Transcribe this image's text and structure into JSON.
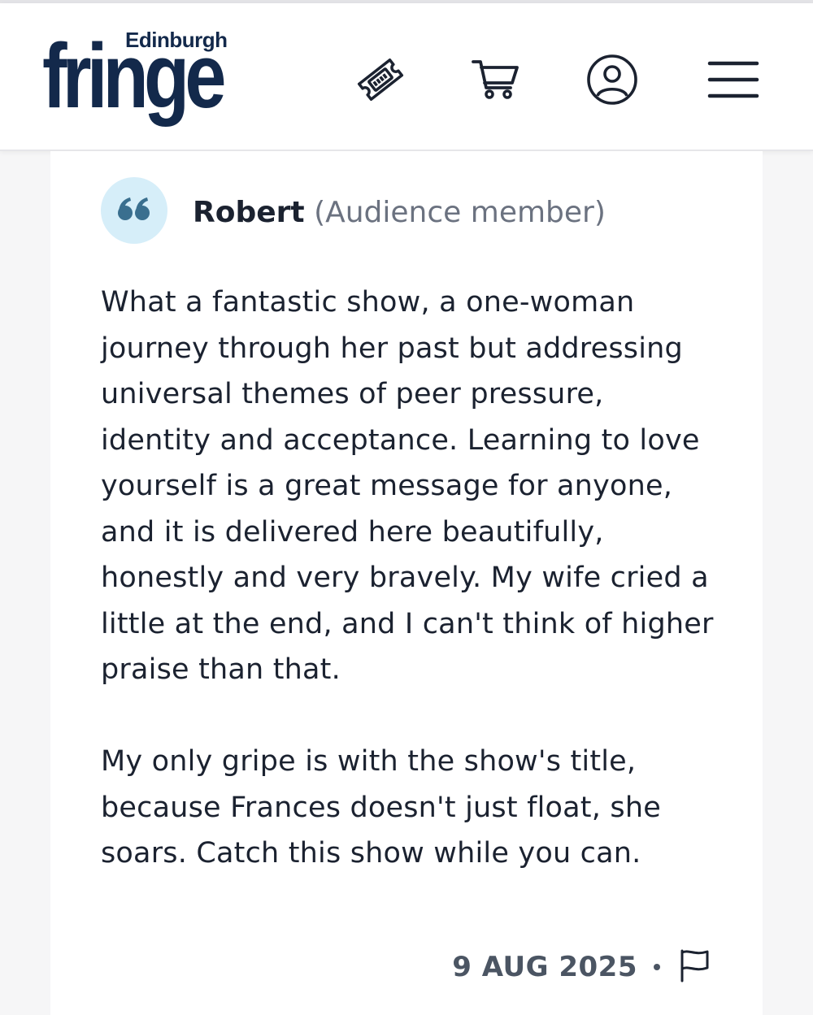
{
  "header": {
    "logo_small": "Edinburgh",
    "logo_big": "fringe",
    "icons": [
      "ticket-icon",
      "cart-icon",
      "user-icon",
      "menu-icon"
    ]
  },
  "review": {
    "author_name": "Robert",
    "author_role": "(Audience member)",
    "paragraphs": [
      "What a fantastic show, a one-woman journey through her past but addressing universal themes of peer pressure, identity and acceptance. Learning to love yourself is a great message for anyone, and it is delivered here beautifully, honestly and very bravely. My wife cried a little at the end, and I can't think of higher praise than that.",
      "My only gripe is with the show's title, because Frances doesn't just float, she soars. Catch this show while you can."
    ],
    "date": "9 AUG 2025"
  },
  "colors": {
    "brand": "#13294b",
    "quote_badge_bg": "#d6eef9",
    "quote_badge_fg": "#3a6f8f",
    "muted": "#6b7280"
  }
}
